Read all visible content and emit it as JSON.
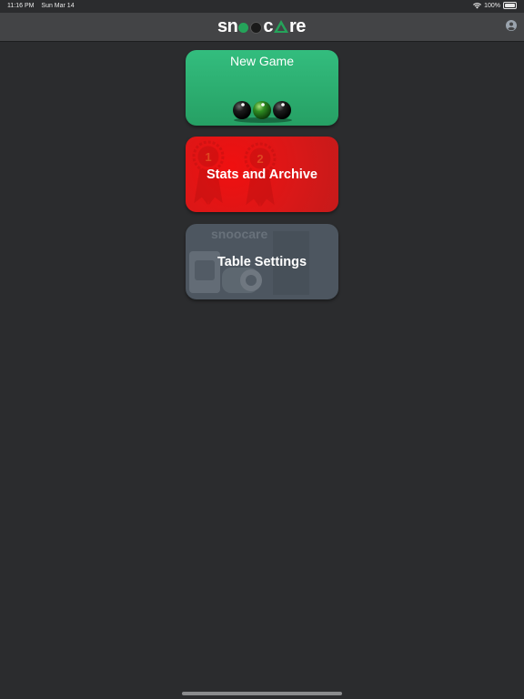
{
  "status_bar": {
    "time": "11:16 PM",
    "date": "Sun Mar 14",
    "battery": "100%"
  },
  "app": {
    "logo_text": "snoocare",
    "logo_parts": [
      "sn",
      "c",
      "re"
    ]
  },
  "cards": {
    "new_game": {
      "label": "New Game",
      "color": "#2db373"
    },
    "stats": {
      "label": "Stats and Archive",
      "color": "#e01515",
      "ribbon_numbers": [
        "1",
        "2"
      ]
    },
    "table": {
      "label": "Table Settings",
      "color": "#4d5660"
    }
  },
  "colors": {
    "background": "#2b2c2e",
    "nav_bar": "#434446",
    "brand_green": "#25a35a"
  }
}
